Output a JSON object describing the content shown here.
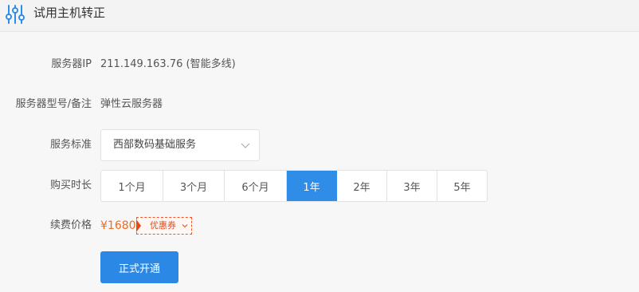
{
  "header": {
    "title": "试用主机转正",
    "icon": "sliders-icon",
    "icon_color": "#2f8de8"
  },
  "form": {
    "ip": {
      "label": "服务器IP",
      "value": "211.149.163.76 (智能多线)"
    },
    "model": {
      "label": "服务器型号/备注",
      "value": "弹性云服务器"
    },
    "service": {
      "label": "服务标准",
      "selected": "西部数码基础服务"
    },
    "duration": {
      "label": "购买时长",
      "options": [
        "1个月",
        "3个月",
        "6个月",
        "1年",
        "2年",
        "3年",
        "5年"
      ],
      "selected": "1年"
    },
    "price": {
      "label": "续费价格",
      "value": "¥1680",
      "coupon_label": "优惠券"
    }
  },
  "submit_label": "正式开通",
  "colors": {
    "accent": "#2f8de8",
    "price": "#f26c1f",
    "coupon": "#e64a19"
  }
}
